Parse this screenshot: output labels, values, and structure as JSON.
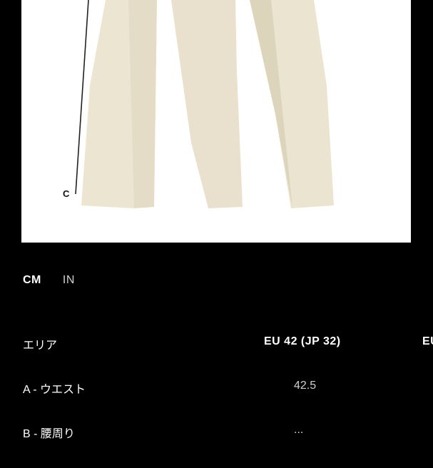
{
  "product_image": {
    "alt": "cream trousers",
    "measure_label": "C",
    "colors": {
      "fabric": "#ece5d2",
      "fabric_shadow": "#d8cfb8",
      "background": "#ffffff"
    }
  },
  "units": {
    "cm": "CM",
    "in": "IN",
    "selected": "CM"
  },
  "table": {
    "area_header": "エリア",
    "size_header": "EU 42 (JP 32)",
    "size_header_2": "EU",
    "rows": [
      {
        "label": "A - ウエスト",
        "value": "42.5"
      },
      {
        "label": "B - 腰周り",
        "value": "..."
      }
    ]
  }
}
